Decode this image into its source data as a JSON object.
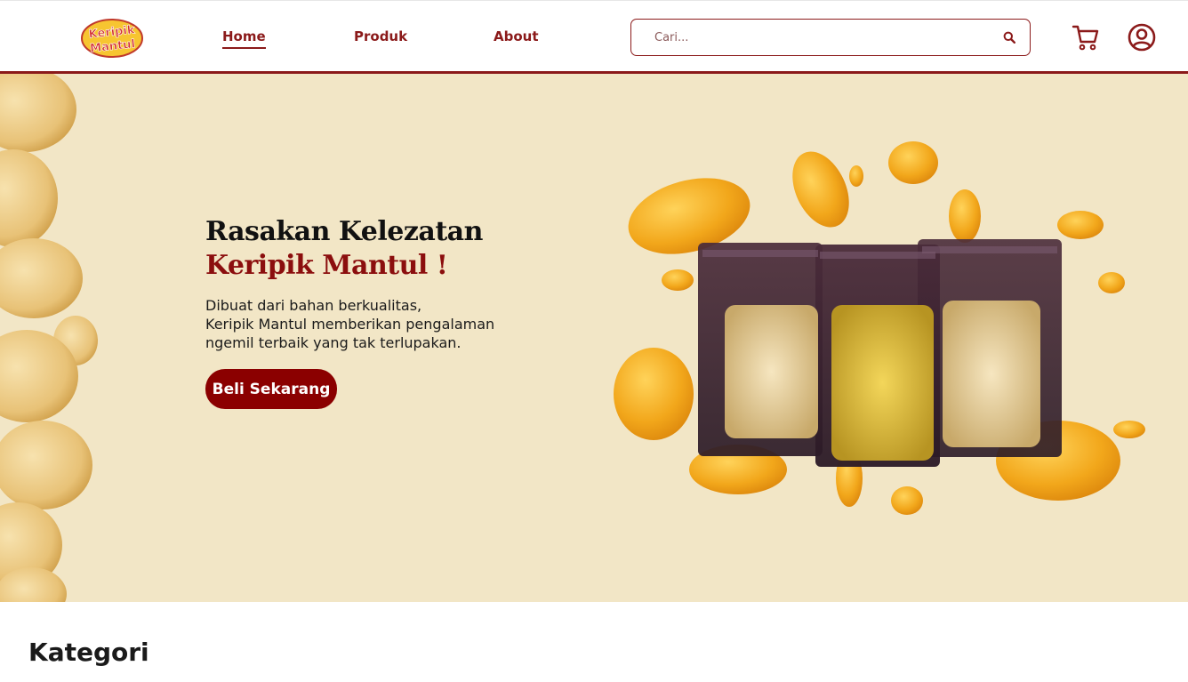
{
  "brand": {
    "logo_text_1": "Keripik",
    "logo_text_2": "Mantul",
    "primary_color": "#8b1a1a",
    "hero_bg": "#f2e6c6"
  },
  "nav": {
    "items": [
      {
        "label": "Home",
        "active": true
      },
      {
        "label": "Produk",
        "active": false
      },
      {
        "label": "About",
        "active": false
      }
    ]
  },
  "search": {
    "placeholder": "Cari...",
    "value": "",
    "icon": "search-icon"
  },
  "header_icons": [
    "cart-icon",
    "user-icon"
  ],
  "hero": {
    "title_line_1": "Rasakan Kelezatan",
    "title_line_2": "Keripik Mantul !",
    "description_lines": [
      "Dibuat dari bahan berkualitas,",
      "Keripik Mantul memberikan pengalaman",
      "ngemil terbaik yang tak terlupakan."
    ],
    "cta_label": "Beli Sekarang"
  },
  "sections": {
    "kategori_title": "Kategori"
  }
}
